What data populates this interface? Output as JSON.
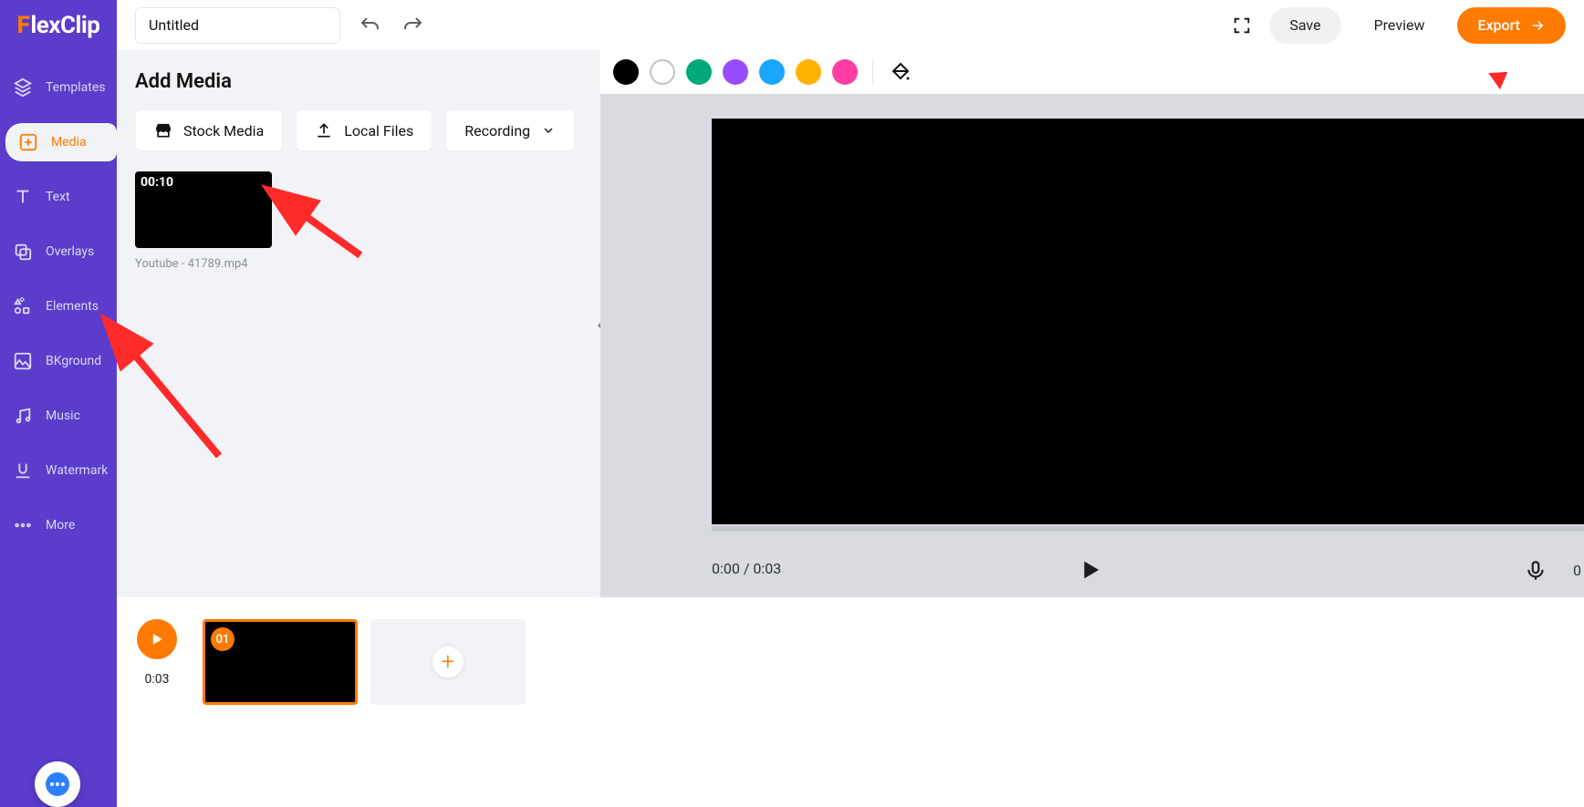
{
  "app": {
    "name": "FlexClip",
    "project_title": "Untitled"
  },
  "topbar": {
    "save_label": "Save",
    "preview_label": "Preview",
    "export_label": "Export"
  },
  "sidebar": {
    "items": [
      {
        "id": "templates",
        "label": "Templates"
      },
      {
        "id": "media",
        "label": "Media"
      },
      {
        "id": "text",
        "label": "Text"
      },
      {
        "id": "overlays",
        "label": "Overlays"
      },
      {
        "id": "elements",
        "label": "Elements"
      },
      {
        "id": "bkground",
        "label": "BKground"
      },
      {
        "id": "music",
        "label": "Music"
      },
      {
        "id": "watermark",
        "label": "Watermark"
      },
      {
        "id": "more",
        "label": "More"
      }
    ],
    "active_id": "media"
  },
  "media_panel": {
    "heading": "Add Media",
    "stock_label": "Stock Media",
    "local_label": "Local Files",
    "recording_label": "Recording",
    "items": [
      {
        "duration": "00:10",
        "filename": "Youtube - 41789.mp4"
      }
    ]
  },
  "canvas": {
    "swatches": [
      "black",
      "outline",
      "green",
      "purple",
      "blue",
      "yellow",
      "pink"
    ],
    "time_display": "0:00 / 0:03",
    "right_stub": "0"
  },
  "timeline": {
    "play_time": "0:03",
    "clips": [
      {
        "index": "01"
      }
    ]
  }
}
